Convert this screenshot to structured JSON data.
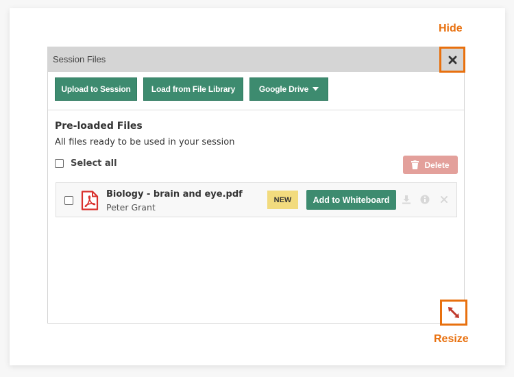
{
  "panel": {
    "title": "Session Files",
    "close_icon": "close-x-icon"
  },
  "toolbar": {
    "upload_label": "Upload to Session",
    "library_label": "Load from File Library",
    "drive_label": "Google Drive",
    "drive_icon": "caret-down-icon"
  },
  "section": {
    "title": "Pre-loaded Files",
    "subtitle": "All files ready to be used in your session",
    "select_all_label": "Select all",
    "delete_label": "Delete",
    "delete_icon": "trash-icon"
  },
  "files": [
    {
      "name": "Biology - brain and eye.pdf",
      "owner": "Peter Grant",
      "badge": "NEW",
      "action_label": "Add to Whiteboard",
      "icons": [
        "pdf-icon",
        "download-icon",
        "info-icon",
        "remove-icon"
      ]
    }
  ],
  "annotations": {
    "hide_label": "Hide",
    "resize_label": "Resize"
  },
  "colors": {
    "accent_green": "#3d8b6f",
    "annotation_orange": "#e8700e",
    "delete_red": "#e3a09b",
    "badge_yellow": "#f2db7e",
    "pdf_red": "#d9302c"
  }
}
